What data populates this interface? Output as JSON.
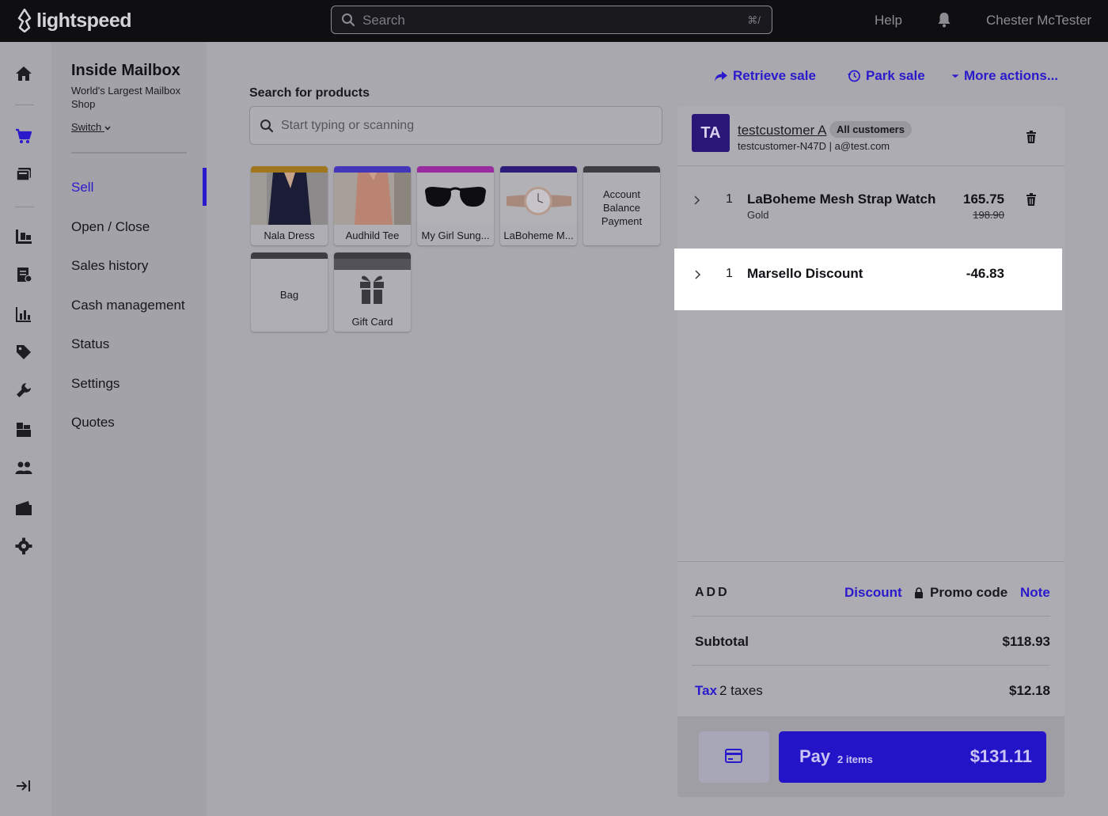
{
  "brand": {
    "name": "lightspeed",
    "accent": "#2a1acb"
  },
  "topbar": {
    "search_placeholder": "Search",
    "search_shortcut": "⌘/",
    "help_label": "Help",
    "notifications_icon": "bell-icon",
    "user_name": "Chester McTester"
  },
  "rail": {
    "icons": [
      "home-icon",
      "cart-icon",
      "register-icon",
      "inventory-icon",
      "invoice-icon",
      "reports-icon",
      "tag-icon",
      "wrench-icon",
      "boxes-icon",
      "customers-icon",
      "wallet-icon",
      "gear-icon",
      "collapse-icon"
    ]
  },
  "store": {
    "name": "Inside Mailbox",
    "subtitle": "World's Largest Mailbox Shop",
    "switch_label": "Switch"
  },
  "nav": {
    "items": [
      {
        "label": "Sell",
        "active": true
      },
      {
        "label": "Open / Close"
      },
      {
        "label": "Sales history"
      },
      {
        "label": "Cash management"
      },
      {
        "label": "Status"
      },
      {
        "label": "Settings"
      },
      {
        "label": "Quotes"
      }
    ]
  },
  "actions": {
    "retrieve": "Retrieve sale",
    "park": "Park sale",
    "more": "More actions..."
  },
  "products": {
    "search_label": "Search for products",
    "search_placeholder": "Start typing or scanning",
    "tiles": [
      {
        "label": "Nala Dress",
        "strip_color": "#a0761e"
      },
      {
        "label": "Audhild Tee",
        "strip_color": "#4436b8"
      },
      {
        "label": "My Girl Sung...",
        "strip_color": "#9a2aa0"
      },
      {
        "label": "LaBoheme M...",
        "strip_color": "#2e1c7a"
      },
      {
        "label": "Account Balance Payment",
        "strip_color": "#3e3e42"
      },
      {
        "label": "Bag",
        "strip_color": "#3e3e42"
      },
      {
        "label": "Gift Card",
        "strip_color": "#3e3e42"
      }
    ]
  },
  "cart": {
    "customer": {
      "initials": "TA",
      "name": "testcustomer A",
      "group": "All customers",
      "meta": "testcustomer-N47D | a@test.com"
    },
    "lines": [
      {
        "qty": "1",
        "name": "LaBoheme Mesh Strap Watch",
        "variant": "Gold",
        "price": "165.75",
        "original_price": "198.90"
      },
      {
        "qty": "1",
        "name": "Marsello Discount",
        "price": "-46.83"
      }
    ],
    "add": {
      "label": "ADD",
      "discount": "Discount",
      "promo": "Promo code",
      "note": "Note"
    },
    "subtotal_label": "Subtotal",
    "subtotal_value": "$118.93",
    "tax_label": "Tax",
    "tax_count": "2 taxes",
    "tax_value": "$12.18",
    "pay_label": "Pay",
    "pay_items": "2 items",
    "pay_amount": "$131.11"
  }
}
